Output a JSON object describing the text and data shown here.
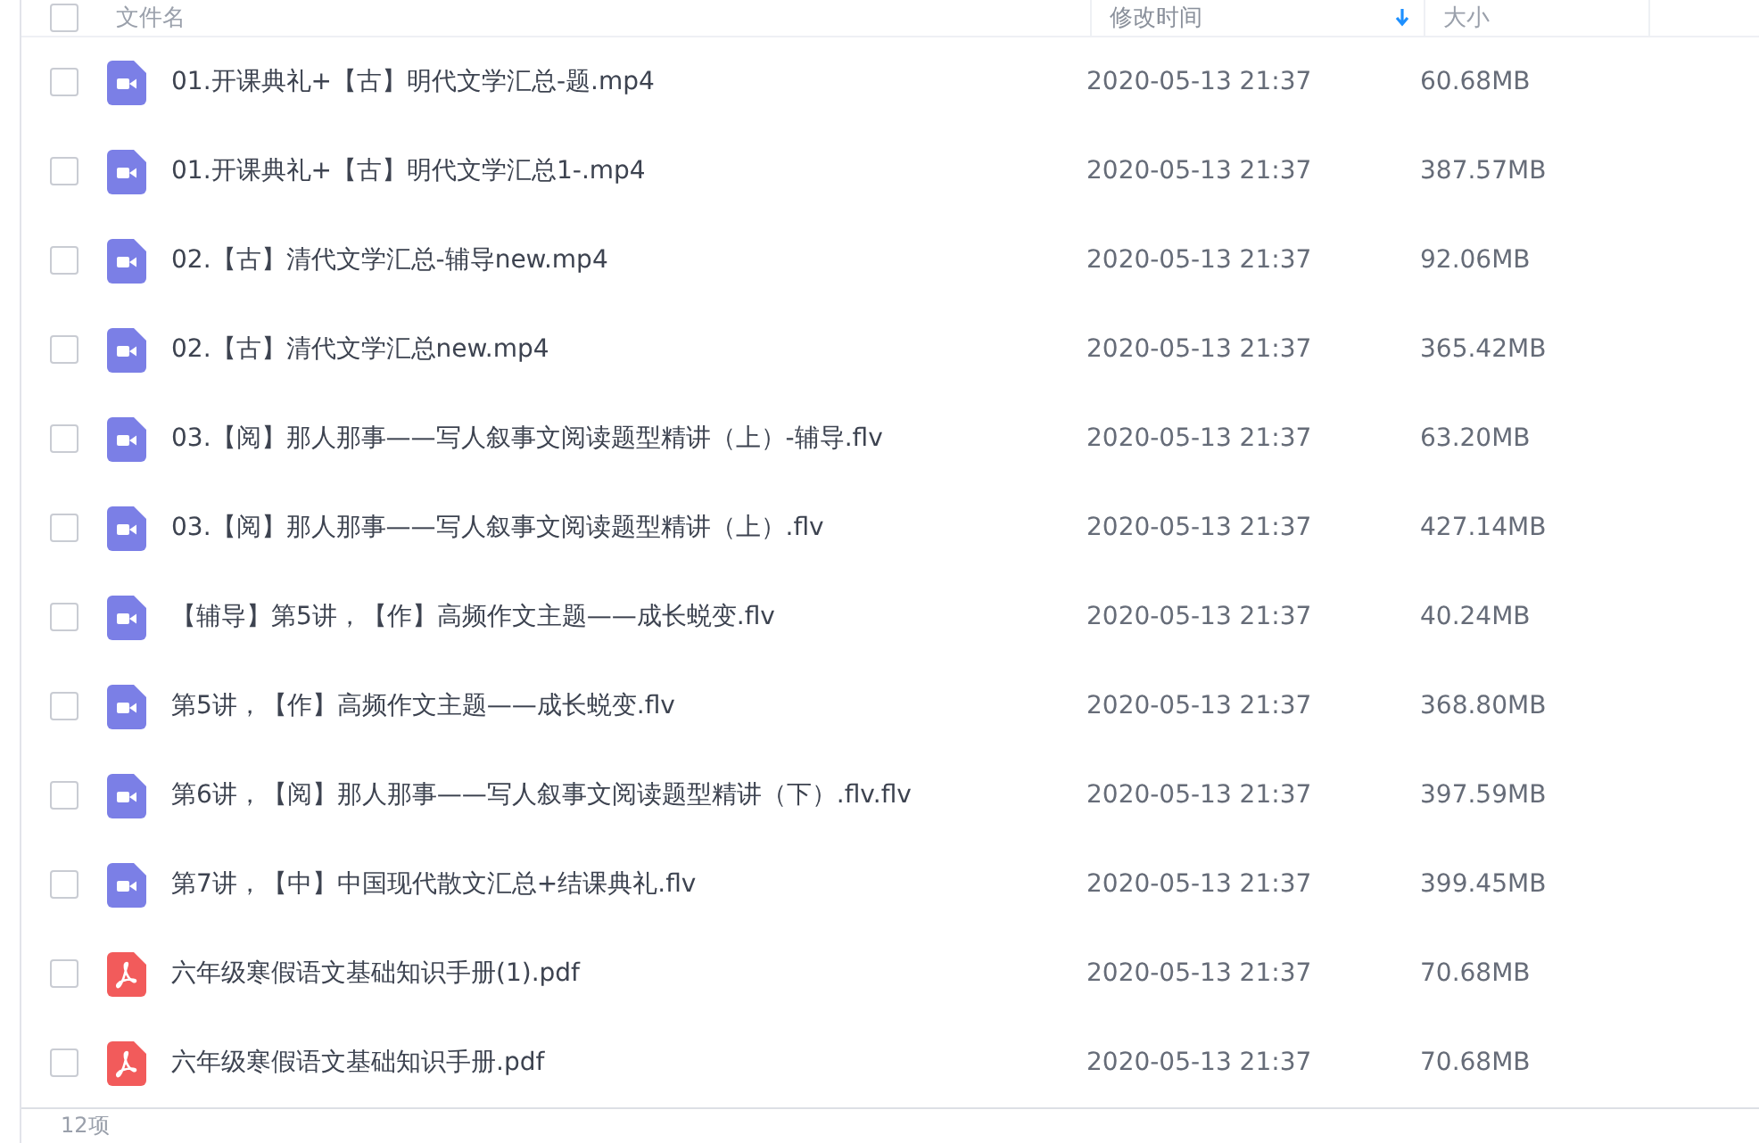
{
  "header": {
    "checked": false,
    "columns": [
      {
        "label": "文件名",
        "sorted": false
      },
      {
        "label": "修改时间",
        "sorted": true
      },
      {
        "label": "大小",
        "sorted": false
      }
    ]
  },
  "files": [
    {
      "kind": "video",
      "name": "01.开课典礼+【古】明代文学汇总-题.mp4",
      "modified": "2020-05-13 21:37",
      "size": "60.68MB",
      "checked": false
    },
    {
      "kind": "video",
      "name": "01.开课典礼+【古】明代文学汇总1-.mp4",
      "modified": "2020-05-13 21:37",
      "size": "387.57MB",
      "checked": false
    },
    {
      "kind": "video",
      "name": "02.【古】清代文学汇总-辅导new.mp4",
      "modified": "2020-05-13 21:37",
      "size": "92.06MB",
      "checked": false
    },
    {
      "kind": "video",
      "name": "02.【古】清代文学汇总new.mp4",
      "modified": "2020-05-13 21:37",
      "size": "365.42MB",
      "checked": false
    },
    {
      "kind": "video",
      "name": "03.【阅】那人那事——写人叙事文阅读题型精讲（上）-辅导.flv",
      "modified": "2020-05-13 21:37",
      "size": "63.20MB",
      "checked": false
    },
    {
      "kind": "video",
      "name": "03.【阅】那人那事——写人叙事文阅读题型精讲（上）.flv",
      "modified": "2020-05-13 21:37",
      "size": "427.14MB",
      "checked": false
    },
    {
      "kind": "video",
      "name": "【辅导】第5讲，【作】高频作文主题——成长蜕变.flv",
      "modified": "2020-05-13 21:37",
      "size": "40.24MB",
      "checked": false
    },
    {
      "kind": "video",
      "name": "第5讲，【作】高频作文主题——成长蜕变.flv",
      "modified": "2020-05-13 21:37",
      "size": "368.80MB",
      "checked": false
    },
    {
      "kind": "video",
      "name": "第6讲，【阅】那人那事——写人叙事文阅读题型精讲（下）.flv.flv",
      "modified": "2020-05-13 21:37",
      "size": "397.59MB",
      "checked": false
    },
    {
      "kind": "video",
      "name": "第7讲，【中】中国现代散文汇总+结课典礼.flv",
      "modified": "2020-05-13 21:37",
      "size": "399.45MB",
      "checked": false
    },
    {
      "kind": "pdf",
      "name": "六年级寒假语文基础知识手册(1).pdf",
      "modified": "2020-05-13 21:37",
      "size": "70.68MB",
      "checked": false
    },
    {
      "kind": "pdf",
      "name": "六年级寒假语文基础知识手册.pdf",
      "modified": "2020-05-13 21:37",
      "size": "70.68MB",
      "checked": false
    }
  ],
  "footer": {
    "count": "12项"
  }
}
